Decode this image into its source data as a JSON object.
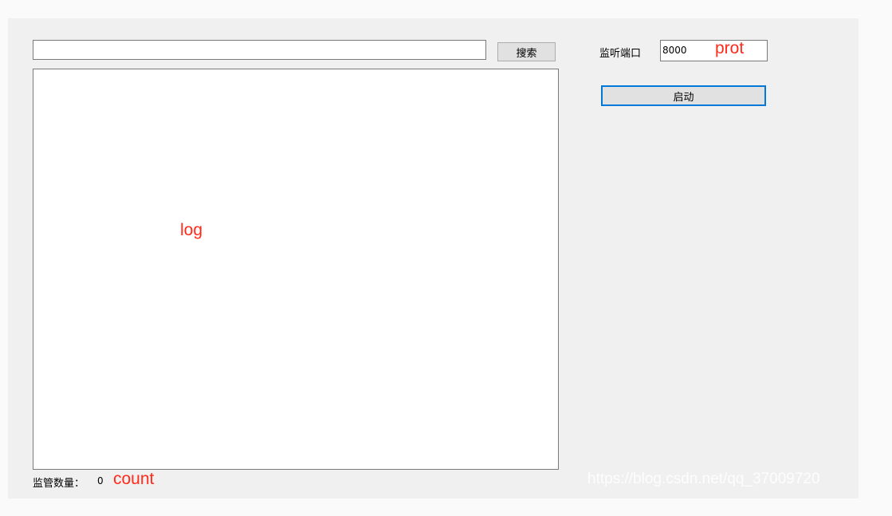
{
  "search": {
    "value": "",
    "button_label": "搜索"
  },
  "log": {
    "annotation": "log",
    "content": ""
  },
  "port": {
    "label": "监听端口",
    "value": "8000",
    "annotation": "prot"
  },
  "start": {
    "button_label": "启动"
  },
  "count": {
    "label": "监管数量：",
    "value": "0",
    "annotation": "count"
  },
  "watermark": "https://blog.csdn.net/qq_37009720",
  "colors": {
    "annotation_red": "#ff2a1a",
    "focus_blue": "#0078d7",
    "form_bg": "#f0f0f0"
  }
}
